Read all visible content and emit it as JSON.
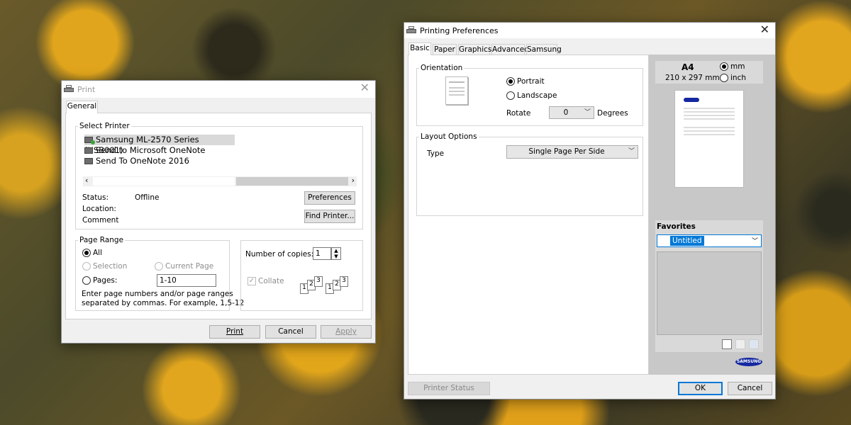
{
  "print_dialog": {
    "title": "Print",
    "tab": "General",
    "select_printer_label": "Select Printer",
    "printers": [
      {
        "name": "Samsung ML-2570 Series (USB001)",
        "selected": true
      },
      {
        "name": "Send to Microsoft OneNote",
        "selected": false
      },
      {
        "name": "Send To OneNote 2016",
        "selected": false
      }
    ],
    "status_label": "Status:",
    "status_value": "Offline",
    "location_label": "Location:",
    "comment_label": "Comment",
    "preferences_button": "Preferences",
    "find_printer_button": "Find Printer...",
    "page_range_label": "Page Range",
    "all_label": "All",
    "selection_label": "Selection",
    "current_page_label": "Current Page",
    "pages_label": "Pages:",
    "pages_value": "1-10",
    "hint_line1": "Enter page numbers and/or page ranges",
    "hint_line2": "separated by commas.  For example, 1,5-12",
    "copies_label": "Number of copies:",
    "copies_value": "1",
    "collate_label": "Collate",
    "collate_checked": true,
    "print_button": "Print",
    "cancel_button": "Cancel",
    "apply_button": "Apply"
  },
  "prefs_dialog": {
    "title": "Printing Preferences",
    "tabs": [
      "Basic",
      "Paper",
      "Graphics",
      "Advanced",
      "Samsung"
    ],
    "active_tab": "Basic",
    "orientation_label": "Orientation",
    "portrait_label": "Portrait",
    "landscape_label": "Landscape",
    "rotate_label": "Rotate",
    "rotate_value": "0",
    "degrees_label": "Degrees",
    "layout_options_label": "Layout Options",
    "type_label": "Type",
    "type_value": "Single Page Per Side",
    "paper_size": "A4",
    "paper_dims": "210 x 297 mm",
    "unit_mm": "mm",
    "unit_inch": "inch",
    "favorites_label": "Favorites",
    "favorites_value": "Untitled",
    "brand": "SAMSUNG",
    "printer_status_button": "Printer Status",
    "ok_button": "OK",
    "cancel_button": "Cancel"
  },
  "colors": {
    "accent": "#0078d7",
    "samsung_blue": "#1428a0",
    "selection_highlight": "#0078d7"
  }
}
